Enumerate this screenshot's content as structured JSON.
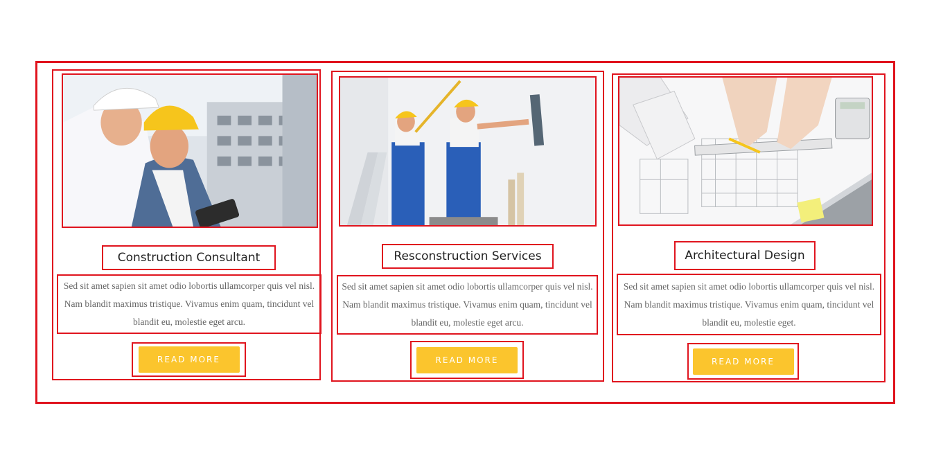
{
  "services": [
    {
      "title": "Construction Consultant",
      "description": "Sed sit amet sapien sit amet odio lobortis ullamcorper quis vel nisl. Nam blandit maximus tristique. Vivamus enim quam, tincidunt vel blandit eu, molestie eget arcu.",
      "button_label": "READ MORE",
      "image": "engineers-with-hard-hats-photo"
    },
    {
      "title": "Resconstruction Services",
      "description": "Sed sit amet sapien sit amet odio lobortis ullamcorper quis vel nisl. Nam blandit maximus tristique. Vivamus enim quam, tincidunt vel blandit eu, molestie eget arcu.",
      "button_label": "READ MORE",
      "image": "workers-plastering-wall-photo"
    },
    {
      "title": "Architectural Design",
      "description": "Sed sit amet sapien sit amet odio lobortis ullamcorper quis vel nisl. Nam blandit maximus tristique. Vivamus enim quam, tincidunt vel blandit eu, molestie eget.",
      "button_label": "READ MORE",
      "image": "architect-drawing-blueprints-photo"
    }
  ],
  "colors": {
    "accent": "#fbc52d",
    "highlight_border": "#e0141e",
    "title_text": "#222222",
    "body_text": "#666666"
  }
}
